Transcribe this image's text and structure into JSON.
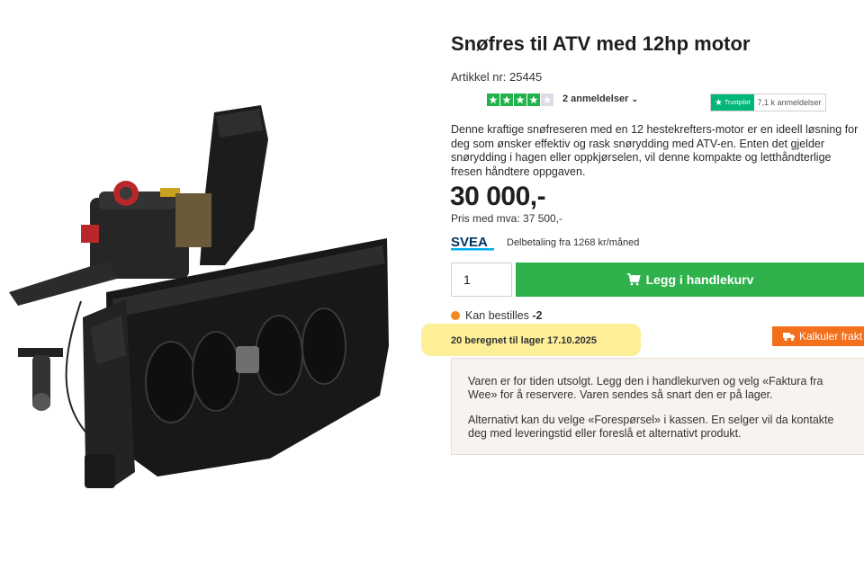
{
  "product": {
    "title": "Snøfres til ATV med 12hp motor",
    "sku_label": "Artikkel nr:",
    "sku_value": "25445",
    "rating_stars": 4,
    "rating_max": 5,
    "reviews_label": "2 anmeldelser",
    "description": "Denne kraftige snøfreseren med en 12 hestekrefters-motor er en ideell løsning for deg som ønsker effektiv og rask snørydding med ATV-en. Enten det gjelder snørydding i hagen eller oppkjørselen, vil denne kompakte og letthåndterlige fresen håndtere oppgaven.",
    "price": "30 000,-",
    "price_vat": "Pris med mva: 37 500,-"
  },
  "trustpilot": {
    "logo_text": "Trustpilot",
    "count": "7,1 k anmeldelser"
  },
  "financing": {
    "logo_text": "SVEA",
    "text": "Delbetaling fra 1268 kr/måned"
  },
  "cart": {
    "quantity": "1",
    "button_label": "Legg i handlekurv"
  },
  "stock": {
    "status_label": "Kan bestilles",
    "status_count": "-2",
    "restock": "20 beregnet til lager 17.10.2025"
  },
  "freight": {
    "button_label": "Kalkuler frakt"
  },
  "notice": {
    "paragraph1": "Varen er for tiden utsolgt. Legg den i handlekurven og velg «Faktura fra Wee» for å reservere. Varen sendes så snart den er på lager.",
    "paragraph2": "Alternativt kan du velge «Forespørsel» i kassen. En selger vil da kontakte deg med leveringstid eller foreslå et alternativt produkt."
  },
  "colors": {
    "green": "#2fb24c",
    "orange": "#f26f1c",
    "highlight": "#fbec86",
    "trustpilot": "#00b67a"
  }
}
